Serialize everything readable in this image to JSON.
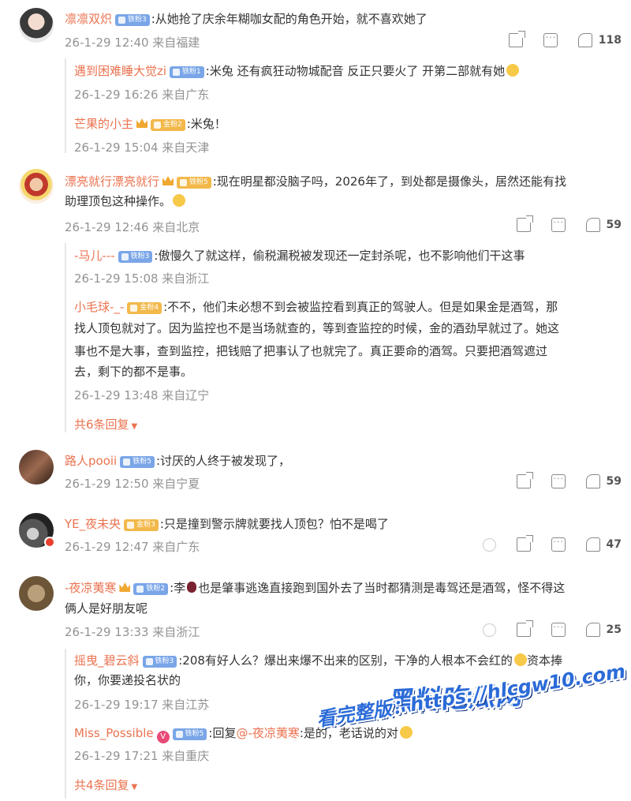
{
  "comments": [
    {
      "name": "凛凛双炽",
      "badge": "铁粉3",
      "text": ":从她抢了庆余年糊咖女配的角色开始，就不喜欢她了",
      "meta": "26-1-29 12:40 来自福建",
      "likes": "118",
      "replies": [
        {
          "name": "遇到困难睡大觉zi",
          "badge": "铁粉1",
          "text": ":米兔 还有疯狂动物城配音 反正只要火了 开第二部就有她",
          "meta": "26-1-29 16:26 来自广东"
        },
        {
          "name": "芒果的小主",
          "badge": "金粉2",
          "text": ":米兔！",
          "meta": "26-1-29 15:04 来自天津"
        }
      ]
    },
    {
      "name": "漂亮就行漂亮就行",
      "badge": "铁粉5",
      "text_l1": ":现在明星都没脑子吗，2026年了，到处都是摄像头，居然还能有找",
      "text_l2": "助理顶包这种操作。",
      "meta": "26-1-29 12:46 来自北京",
      "likes": "59",
      "replies": [
        {
          "name": "-马儿---",
          "badge": "铁粉3",
          "text": ":傲慢久了就这样，偷税漏税被发现还一定封杀呢，也不影响他们干这事",
          "meta": "26-1-29 15:08 来自浙江"
        },
        {
          "name": "小毛球-_-",
          "badge": "金粉4",
          "text_l1": ":不不，他们未必想不到会被监控看到真正的驾驶人。但是如果金是酒驾，那",
          "text_l2": "找人顶包就对了。因为监控也不是当场就查的，等到查监控的时候，金的酒劲早就过了。她这",
          "text_l3": "事也不是大事，查到监控，把钱赔了把事认了也就完了。真正要命的酒驾。只要把酒驾遮过",
          "text_l4": "去，剩下的都不是事。",
          "meta": "26-1-29 13:48 来自辽宁"
        }
      ],
      "more": "共6条回复"
    },
    {
      "name": "路人pooii",
      "badge": "铁粉5",
      "text": ":讨厌的人终于被发现了，",
      "meta": "26-1-29 12:50 来自宁夏",
      "likes": "59"
    },
    {
      "name": "YE_夜未央",
      "badge": "金粉3",
      "text": ":只是撞到警示牌就要找人顶包？怕不是喝了",
      "meta": "26-1-29 12:47 来自广东",
      "likes": "47"
    },
    {
      "name": "-夜凉荑寒",
      "badge": "铁粉2",
      "text_a": ":李",
      "text_b": "也是肇事逃逸直接跑到国外去了当时都猜测是毒驾还是酒驾，怪不得这",
      "text_l2": "俩人是好朋友呢",
      "meta": "26-1-29 13:33 来自浙江",
      "likes": "25",
      "replies": [
        {
          "name": "摇曳_碧云斜",
          "badge": "铁粉3",
          "text_l1": ":208有好人么？爆出来爆不出来的区别，干净的人根本不会红的",
          "text_l1b": "资本捧",
          "text_l2": "你，你要递投名状的",
          "meta": "26-1-29 19:17 来自江苏"
        },
        {
          "name": "Miss_Possible",
          "badge": "铁粉5",
          "text_a": ":回复",
          "mention": "@-夜凉荑寒",
          "text_b": ":是的，老话说的对",
          "meta": "26-1-29 17:21 来自重庆"
        }
      ],
      "more": "共4条回复"
    }
  ],
  "watermark": {
    "line1": "黑料吃瓜网",
    "line2": "看完整版：https://hlcgw10.com"
  },
  "icons": [
    "share-icon",
    "comment-icon",
    "like-icon",
    "dislike-icon",
    "chevron-down-icon"
  ],
  "colors": {
    "name": "#eb7350",
    "meta": "#939393",
    "text": "#333333",
    "iron_badge": "#7aa6e8",
    "gold_badge": "#f2b84a"
  }
}
